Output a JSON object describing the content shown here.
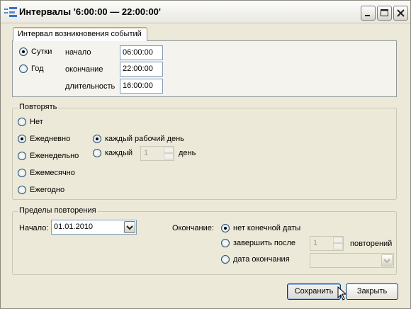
{
  "window": {
    "title": "Интервалы '6:00:00 — 22:00:00'"
  },
  "event_tab": {
    "label": "Интервал возникновения событий",
    "period_options": [
      {
        "label": "Сутки",
        "selected": true
      },
      {
        "label": "Год",
        "selected": false
      }
    ],
    "start_label": "начало",
    "start_value": "06:00:00",
    "end_label": "окончание",
    "end_value": "22:00:00",
    "duration_label": "длительность",
    "duration_value": "16:00:00"
  },
  "repeat": {
    "legend": "Повторять",
    "options": [
      {
        "label": "Нет",
        "selected": false
      },
      {
        "label": "Ежедневно",
        "selected": true
      },
      {
        "label": "Еженедельно",
        "selected": false
      },
      {
        "label": "Ежемесячно",
        "selected": false
      },
      {
        "label": "Ежегодно",
        "selected": false
      }
    ],
    "daily": {
      "every_workday_label": "каждый рабочий день",
      "every_workday_selected": true,
      "every_label": "каждый",
      "every_selected": false,
      "every_value": "1",
      "unit_label": "день"
    }
  },
  "limits": {
    "legend": "Пределы повторения",
    "start_label": "Начало:",
    "start_date": "01.01.2010",
    "end_label": "Окончание:",
    "end_options": [
      {
        "label": "нет конечной даты",
        "selected": true
      },
      {
        "label": "завершить после",
        "selected": false
      },
      {
        "label": "дата окончания",
        "selected": false
      }
    ],
    "occurrences_value": "1",
    "occurrences_label": "повторений",
    "end_date_value": ""
  },
  "buttons": {
    "save": "Сохранить",
    "close": "Закрыть"
  }
}
